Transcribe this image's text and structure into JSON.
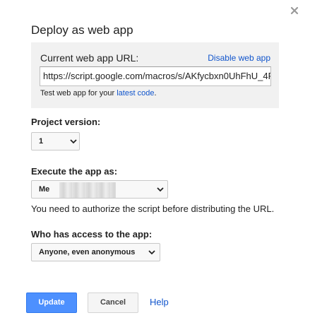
{
  "dialog": {
    "title": "Deploy as web app",
    "close_icon": "close-icon"
  },
  "url_panel": {
    "label": "Current web app URL:",
    "disable_link": "Disable web app",
    "url_value": "https://script.google.com/macros/s/AKfycbxn0UhFhU_4F",
    "test_prefix": "Test web app for your",
    "test_link": "latest code",
    "test_suffix": "."
  },
  "project_version": {
    "label": "Project version:",
    "selected": "1"
  },
  "execute_as": {
    "label": "Execute the app as:",
    "selected": "Me",
    "notice": "You need to authorize the script before distributing the URL."
  },
  "access": {
    "label": "Who has access to the app:",
    "selected": "Anyone, even anonymous"
  },
  "footer": {
    "update_label": "Update",
    "cancel_label": "Cancel",
    "help_label": "Help"
  },
  "colors": {
    "primary": "#4d90fe",
    "link": "#1155cc",
    "panel_bg": "#f1f1f1"
  }
}
